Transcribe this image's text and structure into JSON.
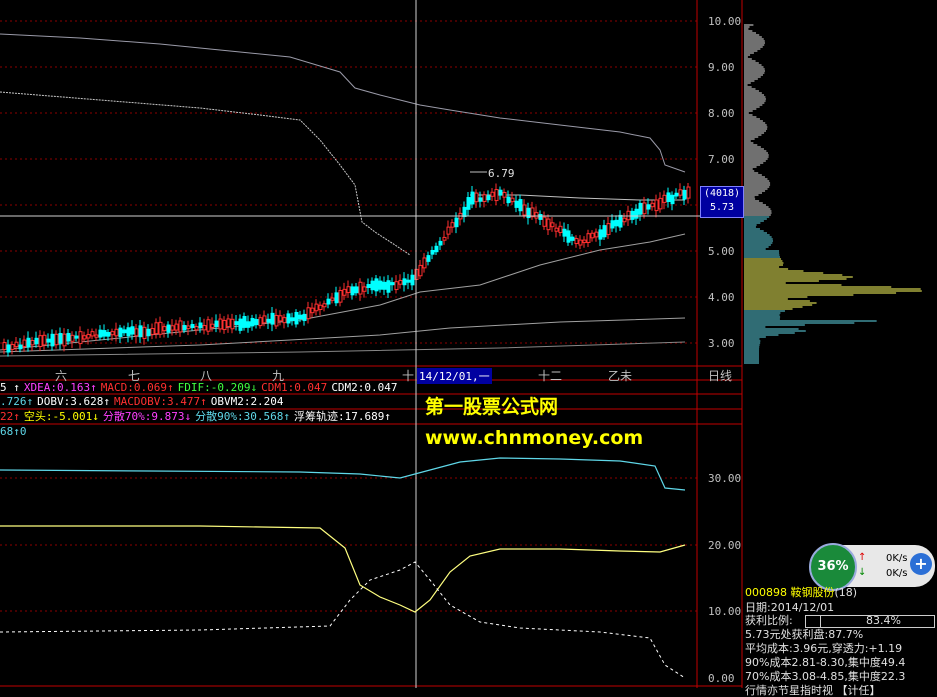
{
  "colors": {
    "bg": "#000000",
    "grid": "#8b0000",
    "price_up": "#ff3030",
    "price_down": "#00ffff",
    "ma": "#c0c0c0",
    "yellow": "#ffff00",
    "cyan": "#5fd7e8",
    "white": "#ffffff"
  },
  "price_axis": {
    "labels": [
      "10.00",
      "9.00",
      "8.00",
      "7.00",
      "6.00",
      "5.00",
      "4.00",
      "3.00"
    ]
  },
  "lower_axis": {
    "labels": [
      "30.00",
      "20.00",
      "10.00",
      "0.00"
    ]
  },
  "months": [
    "六",
    "七",
    "八",
    "九",
    "十",
    "十二",
    "乙未"
  ],
  "crosshair": {
    "date": "14/12/01,一",
    "price_tag_top": "(4018)",
    "price_tag_bottom": "5.73"
  },
  "peak_label": "6.79",
  "period_tab": "日线",
  "indicator_row1": [
    {
      "text": "5 ↑",
      "color": "#ffffff"
    },
    {
      "text": "XDEA:0.163↑",
      "color": "#ff40ff"
    },
    {
      "text": "MACD:0.069↑",
      "color": "#ff3030"
    },
    {
      "text": "FDIF:-0.209↓",
      "color": "#40ff40"
    },
    {
      "text": "CDM1:0.047",
      "color": "#ff3030"
    },
    {
      "text": "CDM2:0.047",
      "color": "#ffffff"
    }
  ],
  "indicator_row2": [
    {
      "text": ".726↑",
      "color": "#5fd7e8"
    },
    {
      "text": "DOBV:3.628↑",
      "color": "#ffffff"
    },
    {
      "text": "MACDOBV:3.477↑",
      "color": "#ff3030"
    },
    {
      "text": "OBVM2:2.204",
      "color": "#ffffff"
    }
  ],
  "indicator_row3": [
    {
      "text": "22↑",
      "color": "#ff3030"
    },
    {
      "text": "空头:-5.001↓",
      "color": "#ffff00"
    },
    {
      "text": "分散70%:9.873↓",
      "color": "#ff40ff"
    },
    {
      "text": "分散90%:30.568↑",
      "color": "#5fd7e8"
    },
    {
      "text": "浮筹轨迹:17.689↑",
      "color": "#ffffff"
    }
  ],
  "indicator_row4": [
    {
      "text": "68↑0",
      "color": "#5fd7e8"
    }
  ],
  "watermark": {
    "line1": "第一股票公式网",
    "line2": "www.chnmoney.com"
  },
  "speed_widget": {
    "percent": "36%",
    "up": "0K/s",
    "down": "0K/s"
  },
  "stock": {
    "code": "000898",
    "name": "鞍钢股份",
    "suffix": "(18)"
  },
  "chip_info": [
    "日期:2014/12/01",
    "获利比例:",
    "83.4%",
    "5.73元处获利盘:87.7%",
    "平均成本:3.96元,穿透力:+1.19",
    "90%成本2.81-8.30,集中度49.4",
    "70%成本3.08-4.85,集中度22.3",
    "行情亦节星指时视 【计任】"
  ]
}
